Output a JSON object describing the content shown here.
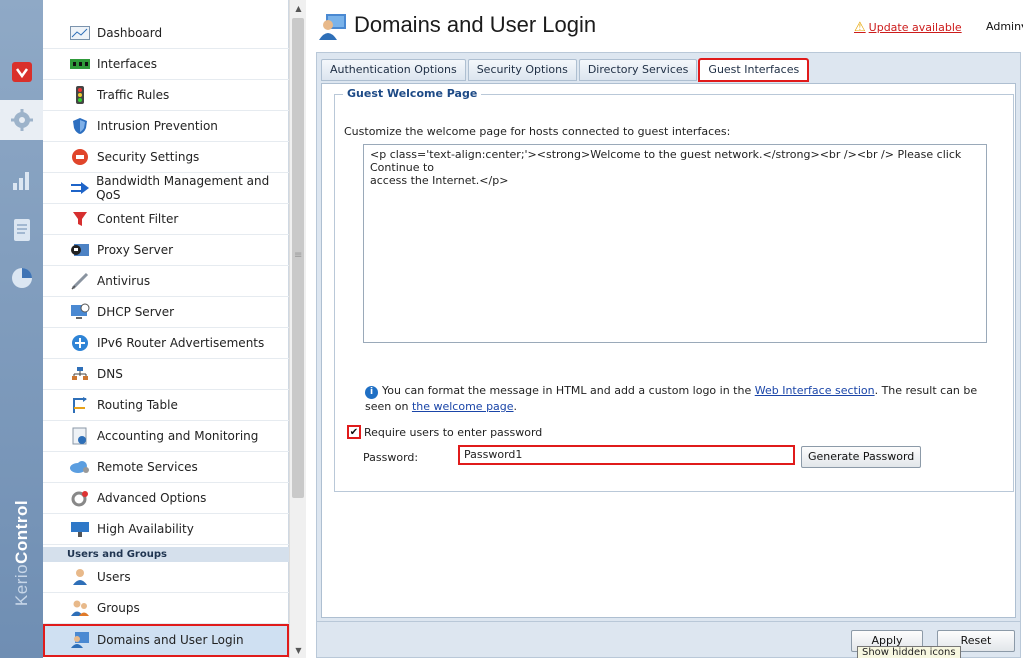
{
  "app": {
    "brand_prefix": "Kerio",
    "brand_suffix": "Control"
  },
  "header": {
    "title": "Domains and User Login",
    "update_text": "Update available",
    "user_menu": "Admin"
  },
  "sidebar": {
    "items": [
      {
        "label": "Dashboard",
        "icon": "dashboard-icon"
      },
      {
        "label": "Interfaces",
        "icon": "interfaces-icon"
      },
      {
        "label": "Traffic Rules",
        "icon": "traffic-light-icon"
      },
      {
        "label": "Intrusion Prevention",
        "icon": "shield-icon"
      },
      {
        "label": "Security Settings",
        "icon": "stop-icon"
      },
      {
        "label": "Bandwidth Management and QoS",
        "icon": "bandwidth-icon"
      },
      {
        "label": "Content Filter",
        "icon": "funnel-icon"
      },
      {
        "label": "Proxy Server",
        "icon": "proxy-icon"
      },
      {
        "label": "Antivirus",
        "icon": "syringe-icon"
      },
      {
        "label": "DHCP Server",
        "icon": "dhcp-icon"
      },
      {
        "label": "IPv6 Router Advertisements",
        "icon": "ipv6-icon"
      },
      {
        "label": "DNS",
        "icon": "dns-icon"
      },
      {
        "label": "Routing Table",
        "icon": "routing-icon"
      },
      {
        "label": "Accounting and Monitoring",
        "icon": "accounting-icon"
      },
      {
        "label": "Remote Services",
        "icon": "cloud-icon"
      },
      {
        "label": "Advanced Options",
        "icon": "gears-icon"
      },
      {
        "label": "High Availability",
        "icon": "high-availability-icon"
      }
    ],
    "section_users": "Users and Groups",
    "user_items": [
      {
        "label": "Users",
        "icon": "user-icon"
      },
      {
        "label": "Groups",
        "icon": "group-icon"
      },
      {
        "label": "Domains and User Login",
        "icon": "domain-user-icon"
      }
    ]
  },
  "tabs": [
    {
      "label": "Authentication Options"
    },
    {
      "label": "Security Options"
    },
    {
      "label": "Directory Services"
    },
    {
      "label": "Guest Interfaces"
    }
  ],
  "guest": {
    "group_title": "Guest Welcome Page",
    "description": "Customize the welcome page for hosts connected to guest interfaces:",
    "html_line1": "<p class='text-align:center;'><strong>Welcome to the guest network.</strong><br /><br /> Please click Continue to",
    "html_line2": "access the Internet.</p>",
    "info_text1": "You can format the message in HTML and add a custom logo in the ",
    "info_link1": "Web Interface section",
    "info_text2": ". The result can be seen on ",
    "info_link2": "the welcome page",
    "info_text3": ".",
    "require_password_label": "Require users to enter password",
    "password_label": "Password:",
    "password_value": "Password1",
    "generate_button": "Generate Password"
  },
  "footer": {
    "apply": "Apply",
    "reset": "Reset",
    "tooltip": "Show hidden icons"
  },
  "colors": {
    "highlight_red": "#e01b1b",
    "panel_blue": "#dde6f0",
    "legend_blue": "#1d4a86",
    "link_blue": "#1a45a8"
  }
}
